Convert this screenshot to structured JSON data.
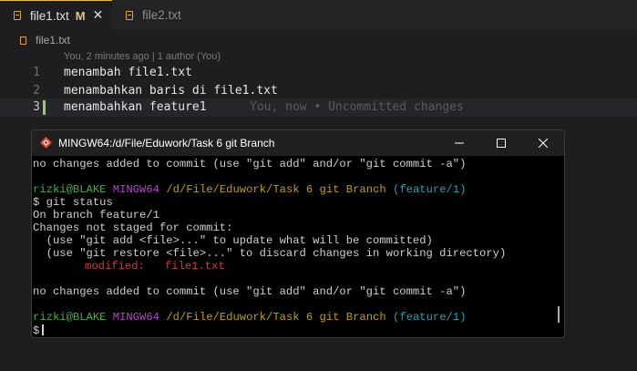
{
  "editor": {
    "tabs": [
      {
        "label": "file1.txt",
        "badge": "M",
        "close": "✕",
        "active": true
      },
      {
        "label": "file2.txt",
        "active": false
      }
    ],
    "breadcrumb": "file1.txt",
    "blame_header": "You, 2 minutes ago | 1 author (You)",
    "lines": [
      {
        "number": "1",
        "text": "menambah file1.txt"
      },
      {
        "number": "2",
        "text": "menambahkan baris di file1.txt"
      },
      {
        "number": "3",
        "text": "menambahkan feature1"
      }
    ],
    "inline_blame": "You, now • Uncommitted changes"
  },
  "terminal": {
    "title": "MINGW64:/d/File/Eduwork/Task 6 git Branch",
    "line_top": "no changes added to commit (use \"git add\" and/or \"git commit -a\")",
    "prompt1": {
      "user": "rizki@BLAKE",
      "env": "MINGW64",
      "path": "/d/File/Eduwork/Task 6 git Branch",
      "branch": "(feature/1)"
    },
    "command": "$ git status",
    "out1": "On branch feature/1",
    "out2": "Changes not staged for commit:",
    "out3": "  (use \"git add <file>...\" to update what will be committed)",
    "out4": "  (use \"git restore <file>...\" to discard changes in working directory)",
    "modified_label": "modified:",
    "modified_file": "file1.txt",
    "out5": "no changes added to commit (use \"git add\" and/or \"git commit -a\")",
    "prompt2": {
      "user": "rizki@BLAKE",
      "env": "MINGW64",
      "path": "/d/File/Eduwork/Task 6 git Branch",
      "branch": "(feature/1)"
    },
    "input_prompt": "$"
  },
  "colors": {
    "git_added": "#9fc56f",
    "modified_badge": "#e2c08d",
    "prompt_user": "#40b048",
    "prompt_env": "#b148c6",
    "prompt_path": "#c0a000",
    "prompt_branch": "#21a3b2",
    "modified_text": "#d03a3a"
  }
}
